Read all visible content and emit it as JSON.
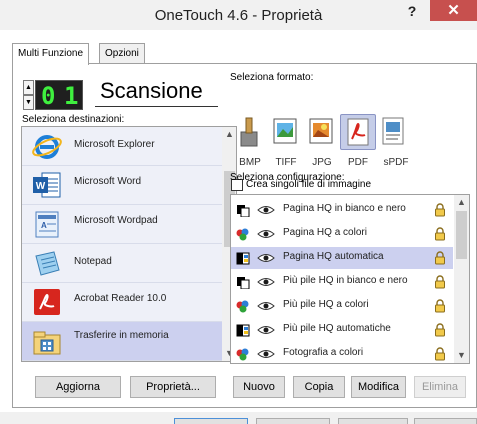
{
  "window": {
    "title": "OneTouch 4.6 - Proprietà",
    "help_label": "?",
    "close_label": "✕"
  },
  "tabs": [
    {
      "label": "Multi Funzione",
      "active": true
    },
    {
      "label": "Opzioni",
      "active": false
    }
  ],
  "mode": {
    "number": "01",
    "name": "Scansione",
    "spin_up": "▲",
    "spin_down": "▼"
  },
  "destinations": {
    "label": "Seleziona destinazioni:",
    "items": [
      {
        "label": "Microsoft Explorer",
        "icon": "internet-explorer-icon",
        "selected": false
      },
      {
        "label": "Microsoft Word",
        "icon": "word-icon",
        "selected": false
      },
      {
        "label": "Microsoft Wordpad",
        "icon": "wordpad-icon",
        "selected": false
      },
      {
        "label": "Notepad",
        "icon": "notepad-icon",
        "selected": false
      },
      {
        "label": "Acrobat Reader 10.0",
        "icon": "acrobat-icon",
        "selected": false
      },
      {
        "label": "Trasferire in memoria",
        "icon": "storage-icon",
        "selected": true
      }
    ]
  },
  "formats": {
    "label": "Seleziona formato:",
    "items": [
      {
        "label": "BMP",
        "selected": false
      },
      {
        "label": "TIFF",
        "selected": false
      },
      {
        "label": "JPG",
        "selected": false
      },
      {
        "label": "PDF",
        "selected": true
      },
      {
        "label": "sPDF",
        "selected": false
      }
    ],
    "single_files_label": "Crea singoli file di immagine",
    "single_files_checked": false
  },
  "configurations": {
    "label": "Seleziona configurazione:",
    "items": [
      {
        "label": "Pagina HQ in bianco e nero",
        "icon": "bw-page-icon",
        "selected": false
      },
      {
        "label": "Pagina HQ a colori",
        "icon": "color-page-icon",
        "selected": false
      },
      {
        "label": "Pagina HQ automatica",
        "icon": "auto-page-icon",
        "selected": true
      },
      {
        "label": "Più pile  HQ in bianco e nero",
        "icon": "bw-page-icon",
        "selected": false
      },
      {
        "label": "Più pile  HQ a colori",
        "icon": "color-page-icon",
        "selected": false
      },
      {
        "label": "Più pile  HQ automatiche",
        "icon": "auto-page-icon",
        "selected": false
      },
      {
        "label": "Fotografia a colori",
        "icon": "color-page-icon",
        "selected": false
      }
    ]
  },
  "buttons": {
    "refresh": "Aggiorna",
    "properties": "Proprietà...",
    "new": "Nuovo",
    "copy": "Copia",
    "edit": "Modifica",
    "delete": "Elimina"
  },
  "colors": {
    "selection": "#ccd0ef",
    "list_item_bg": "#eef0f8",
    "lcd_digit": "#3ff03f",
    "close_button": "#c7504e"
  }
}
